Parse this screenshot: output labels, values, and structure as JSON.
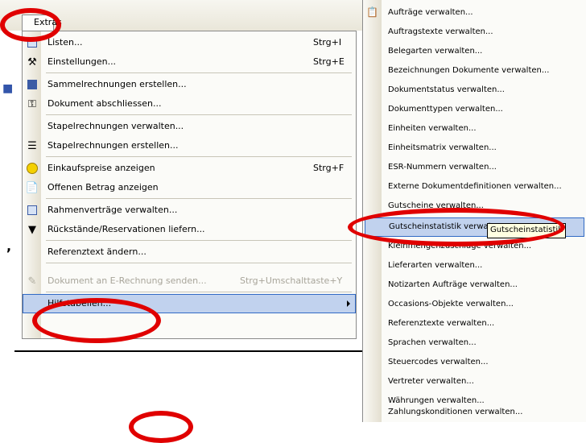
{
  "menubar": {
    "extras_label": "Extras",
    "next_label": "?"
  },
  "left_edge": {
    "comma": ","
  },
  "menu": {
    "items": [
      {
        "label": "Listen...",
        "shortcut": "Strg+I",
        "icon": "list-search-icon"
      },
      {
        "label": "Einstellungen...",
        "shortcut": "Strg+E",
        "icon": "tools-icon"
      },
      {
        "label": "Sammelrechnungen erstellen...",
        "shortcut": "",
        "icon": "table-icon"
      },
      {
        "label": "Dokument abschliessen...",
        "shortcut": "",
        "icon": "key-icon"
      },
      {
        "label": "Stapelrechnungen verwalten...",
        "shortcut": "",
        "icon": ""
      },
      {
        "label": "Stapelrechnungen erstellen...",
        "shortcut": "",
        "icon": "stack-icon"
      },
      {
        "label": "Einkaufspreise anzeigen",
        "shortcut": "Strg+F",
        "icon": "smiley-icon"
      },
      {
        "label": "Offenen Betrag anzeigen",
        "shortcut": "",
        "icon": "document-coin-icon"
      },
      {
        "label": "Rahmenverträge verwalten...",
        "shortcut": "",
        "icon": "calendar-icon"
      },
      {
        "label": "Rückstände/Reservationen liefern...",
        "shortcut": "",
        "icon": "funnel-icon"
      },
      {
        "label": "Referenztext ändern...",
        "shortcut": "",
        "icon": ""
      },
      {
        "label": "Dokument an E-Rechnung senden...",
        "shortcut": "Strg+Umschalttaste+Y",
        "icon": "pen-document-icon"
      },
      {
        "label": "Hilfstabellen...",
        "shortcut": "",
        "icon": ""
      }
    ]
  },
  "submenu": {
    "items": [
      "Aufträge verwalten...",
      "Auftragstexte verwalten...",
      "Belegarten verwalten...",
      "Bezeichnungen Dokumente verwalten...",
      "Dokumentstatus verwalten...",
      "Dokumenttypen verwalten...",
      "Einheiten verwalten...",
      "Einheitsmatrix verwalten...",
      "ESR-Nummern verwalten...",
      "Externe Dokumentdefinitionen verwalten...",
      "Gutscheine verwalten...",
      "Gutscheinstatistik verwalten...",
      "Kleinmengenzuschläge verwalten...",
      "Lieferarten verwalten...",
      "Notizarten Aufträge verwalten...",
      "Occasions-Objekte verwalten...",
      "Referenztexte verwalten...",
      "Sprachen verwalten...",
      "Steuercodes verwalten...",
      "Vertreter verwalten...",
      "Währungen verwalten...",
      "Zahlungskonditionen verwalten..."
    ],
    "tooltip": "Gutscheinstatistik"
  },
  "colors": {
    "highlight": "#c1d2ee",
    "highlight_border": "#316ac5",
    "annotation_ring": "#e00000"
  }
}
